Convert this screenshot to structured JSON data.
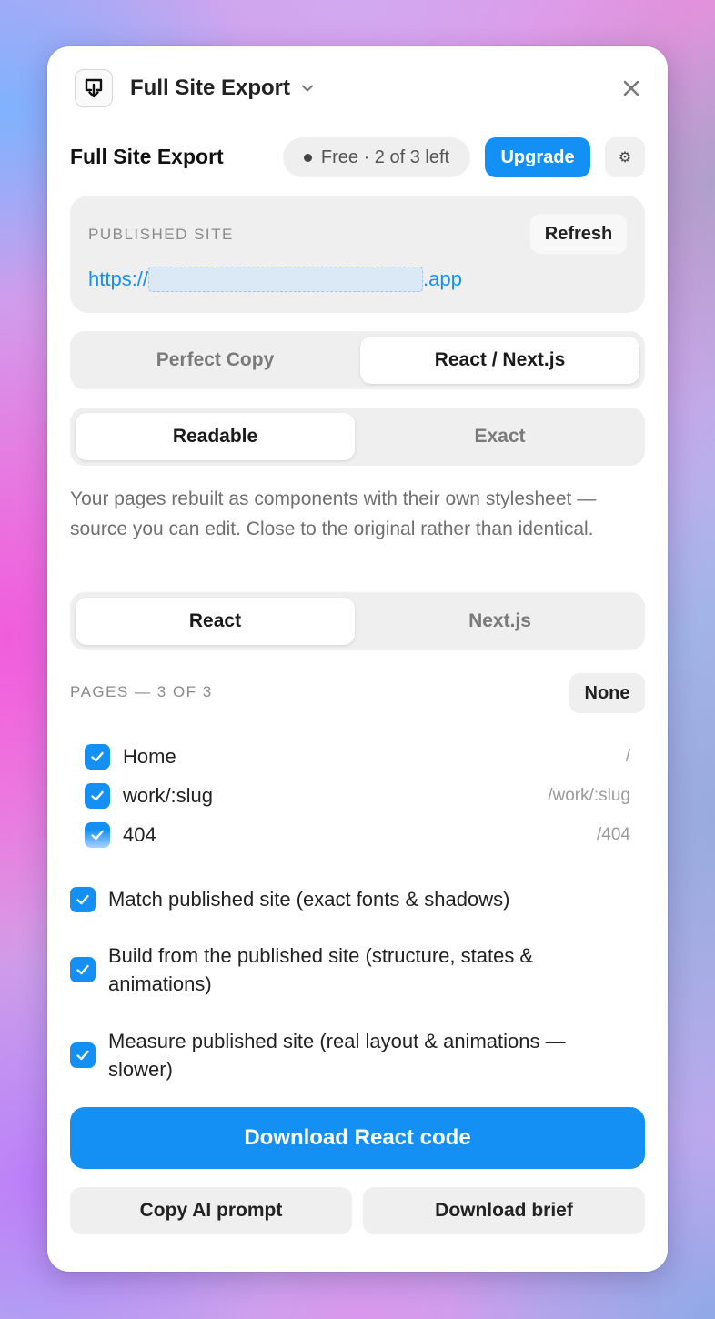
{
  "header": {
    "title": "Full Site Export",
    "close_icon": "close-icon",
    "app_icon": "download-icon"
  },
  "toolbar": {
    "section_title": "Full Site Export",
    "plan_status": "Free · 2 of 3 left",
    "upgrade_label": "Upgrade",
    "settings_icon": "gear-icon"
  },
  "published": {
    "label": "PUBLISHED SITE",
    "refresh_label": "Refresh",
    "url_prefix": "https://",
    "url_suffix": ".app"
  },
  "export_mode": {
    "options": [
      "Perfect Copy",
      "React / Next.js"
    ],
    "selected": "React / Next.js"
  },
  "style_mode": {
    "options": [
      "Readable",
      "Exact"
    ],
    "selected": "Readable"
  },
  "description": "Your pages rebuilt as components with their own stylesheet — source you can edit. Close to the original rather than identical.",
  "framework": {
    "options": [
      "React",
      "Next.js"
    ],
    "selected": "React"
  },
  "pages": {
    "label": "PAGES — 3 OF 3",
    "none_label": "None",
    "items": [
      {
        "name": "Home",
        "path": "/",
        "checked": true
      },
      {
        "name": "work/:slug",
        "path": "/work/:slug",
        "checked": true
      },
      {
        "name": "404",
        "path": "/404",
        "checked": true
      }
    ]
  },
  "options": [
    {
      "label": "Match published site (exact fonts & shadows)",
      "checked": true
    },
    {
      "label": "Build from the published site (structure, states & animations)",
      "checked": true
    },
    {
      "label": "Measure published site (real layout & animations — slower)",
      "checked": true
    }
  ],
  "actions": {
    "download_label": "Download React code",
    "copy_prompt_label": "Copy AI prompt",
    "download_brief_label": "Download brief"
  },
  "colors": {
    "accent": "#1490f5",
    "panel_bg": "#ffffff",
    "control_bg": "#efefef"
  }
}
